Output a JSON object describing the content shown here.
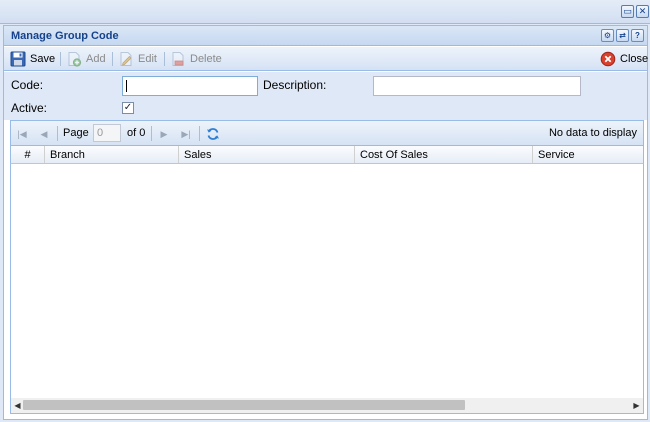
{
  "window": {
    "restore_glyph": "▭",
    "close_glyph": "✕"
  },
  "panel": {
    "title": "Manage Group Code",
    "tool_glyphs": [
      "⚙",
      "⇄",
      "?"
    ]
  },
  "toolbar": {
    "save_label": "Save",
    "add_label": "Add",
    "edit_label": "Edit",
    "delete_label": "Delete",
    "close_label": "Close"
  },
  "form": {
    "code_label": "Code:",
    "code_value": "",
    "description_label": "Description:",
    "description_value": "",
    "active_label": "Active:",
    "active_checked": true,
    "check_glyph": "✓"
  },
  "paging": {
    "first_glyph": "|◀",
    "prev_glyph": "◀",
    "page_label": "Page",
    "page_value": "0",
    "of_label": "of 0",
    "next_glyph": "▶",
    "last_glyph": "▶|",
    "status": "No data to display"
  },
  "grid": {
    "columns": [
      "#",
      "Branch",
      "Sales",
      "Cost Of Sales",
      "Service"
    ],
    "rows": []
  },
  "scrollbar": {
    "left_glyph": "◀",
    "right_glyph": "▶",
    "thumb_fraction": 0.71
  },
  "colors": {
    "accent": "#15428b",
    "border": "#99bbe8",
    "background": "#dfe8f6",
    "close_red": "#d9412f"
  },
  "icons": {
    "save": "floppy-disk-icon",
    "add": "add-document-icon",
    "edit": "edit-document-icon",
    "delete": "delete-document-icon",
    "close": "close-circle-icon",
    "refresh": "refresh-icon"
  }
}
